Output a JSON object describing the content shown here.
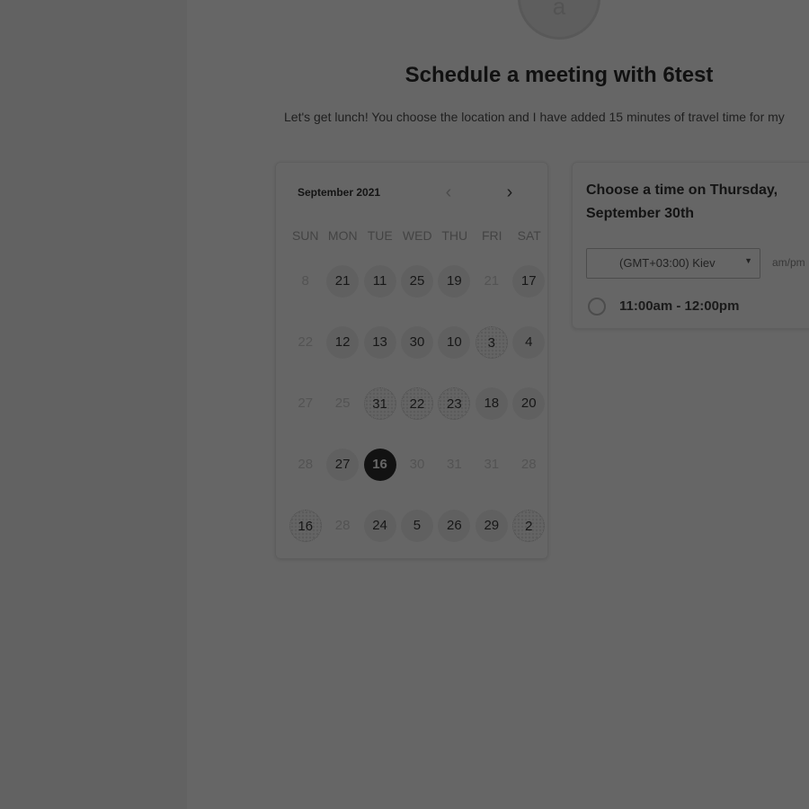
{
  "header": {
    "avatar_letter": "a",
    "title": "Schedule a meeting with 6test",
    "description": "Let's get lunch! You choose the location and I have added 15 minutes of travel time for my"
  },
  "calendar": {
    "month_label": "September 2021",
    "prev_icon": "chevron-left-icon",
    "next_icon": "chevron-right-icon",
    "weekdays": [
      "SUN",
      "MON",
      "TUE",
      "WED",
      "THU",
      "FRI",
      "SAT"
    ],
    "weeks": [
      [
        {
          "label": "8",
          "state": "disabled"
        },
        {
          "label": "21",
          "state": "available"
        },
        {
          "label": "11",
          "state": "available"
        },
        {
          "label": "25",
          "state": "available"
        },
        {
          "label": "19",
          "state": "available"
        },
        {
          "label": "21",
          "state": "disabled"
        },
        {
          "label": "17",
          "state": "available"
        }
      ],
      [
        {
          "label": "22",
          "state": "disabled"
        },
        {
          "label": "12",
          "state": "available"
        },
        {
          "label": "13",
          "state": "available"
        },
        {
          "label": "30",
          "state": "available"
        },
        {
          "label": "10",
          "state": "available"
        },
        {
          "label": "3",
          "state": "dotted"
        },
        {
          "label": "4",
          "state": "available"
        }
      ],
      [
        {
          "label": "27",
          "state": "disabled"
        },
        {
          "label": "25",
          "state": "disabled"
        },
        {
          "label": "31",
          "state": "dotted"
        },
        {
          "label": "22",
          "state": "dotted"
        },
        {
          "label": "23",
          "state": "dotted"
        },
        {
          "label": "18",
          "state": "available"
        },
        {
          "label": "20",
          "state": "available"
        }
      ],
      [
        {
          "label": "28",
          "state": "disabled"
        },
        {
          "label": "27",
          "state": "available"
        },
        {
          "label": "16",
          "state": "selected"
        },
        {
          "label": "30",
          "state": "disabled"
        },
        {
          "label": "31",
          "state": "disabled"
        },
        {
          "label": "31",
          "state": "disabled"
        },
        {
          "label": "28",
          "state": "disabled"
        }
      ],
      [
        {
          "label": "16",
          "state": "dotted"
        },
        {
          "label": "28",
          "state": "disabled"
        },
        {
          "label": "24",
          "state": "available"
        },
        {
          "label": "5",
          "state": "available"
        },
        {
          "label": "26",
          "state": "available"
        },
        {
          "label": "29",
          "state": "available"
        },
        {
          "label": "2",
          "state": "dotted"
        }
      ]
    ]
  },
  "times": {
    "heading": "Choose a time on Thursday, September 30th",
    "timezone": "(GMT+03:00) Kiev",
    "caret_icon": "caret-down-icon",
    "format_toggle": "am/pm",
    "slots": [
      {
        "label": "11:00am - 12:00pm"
      }
    ]
  }
}
